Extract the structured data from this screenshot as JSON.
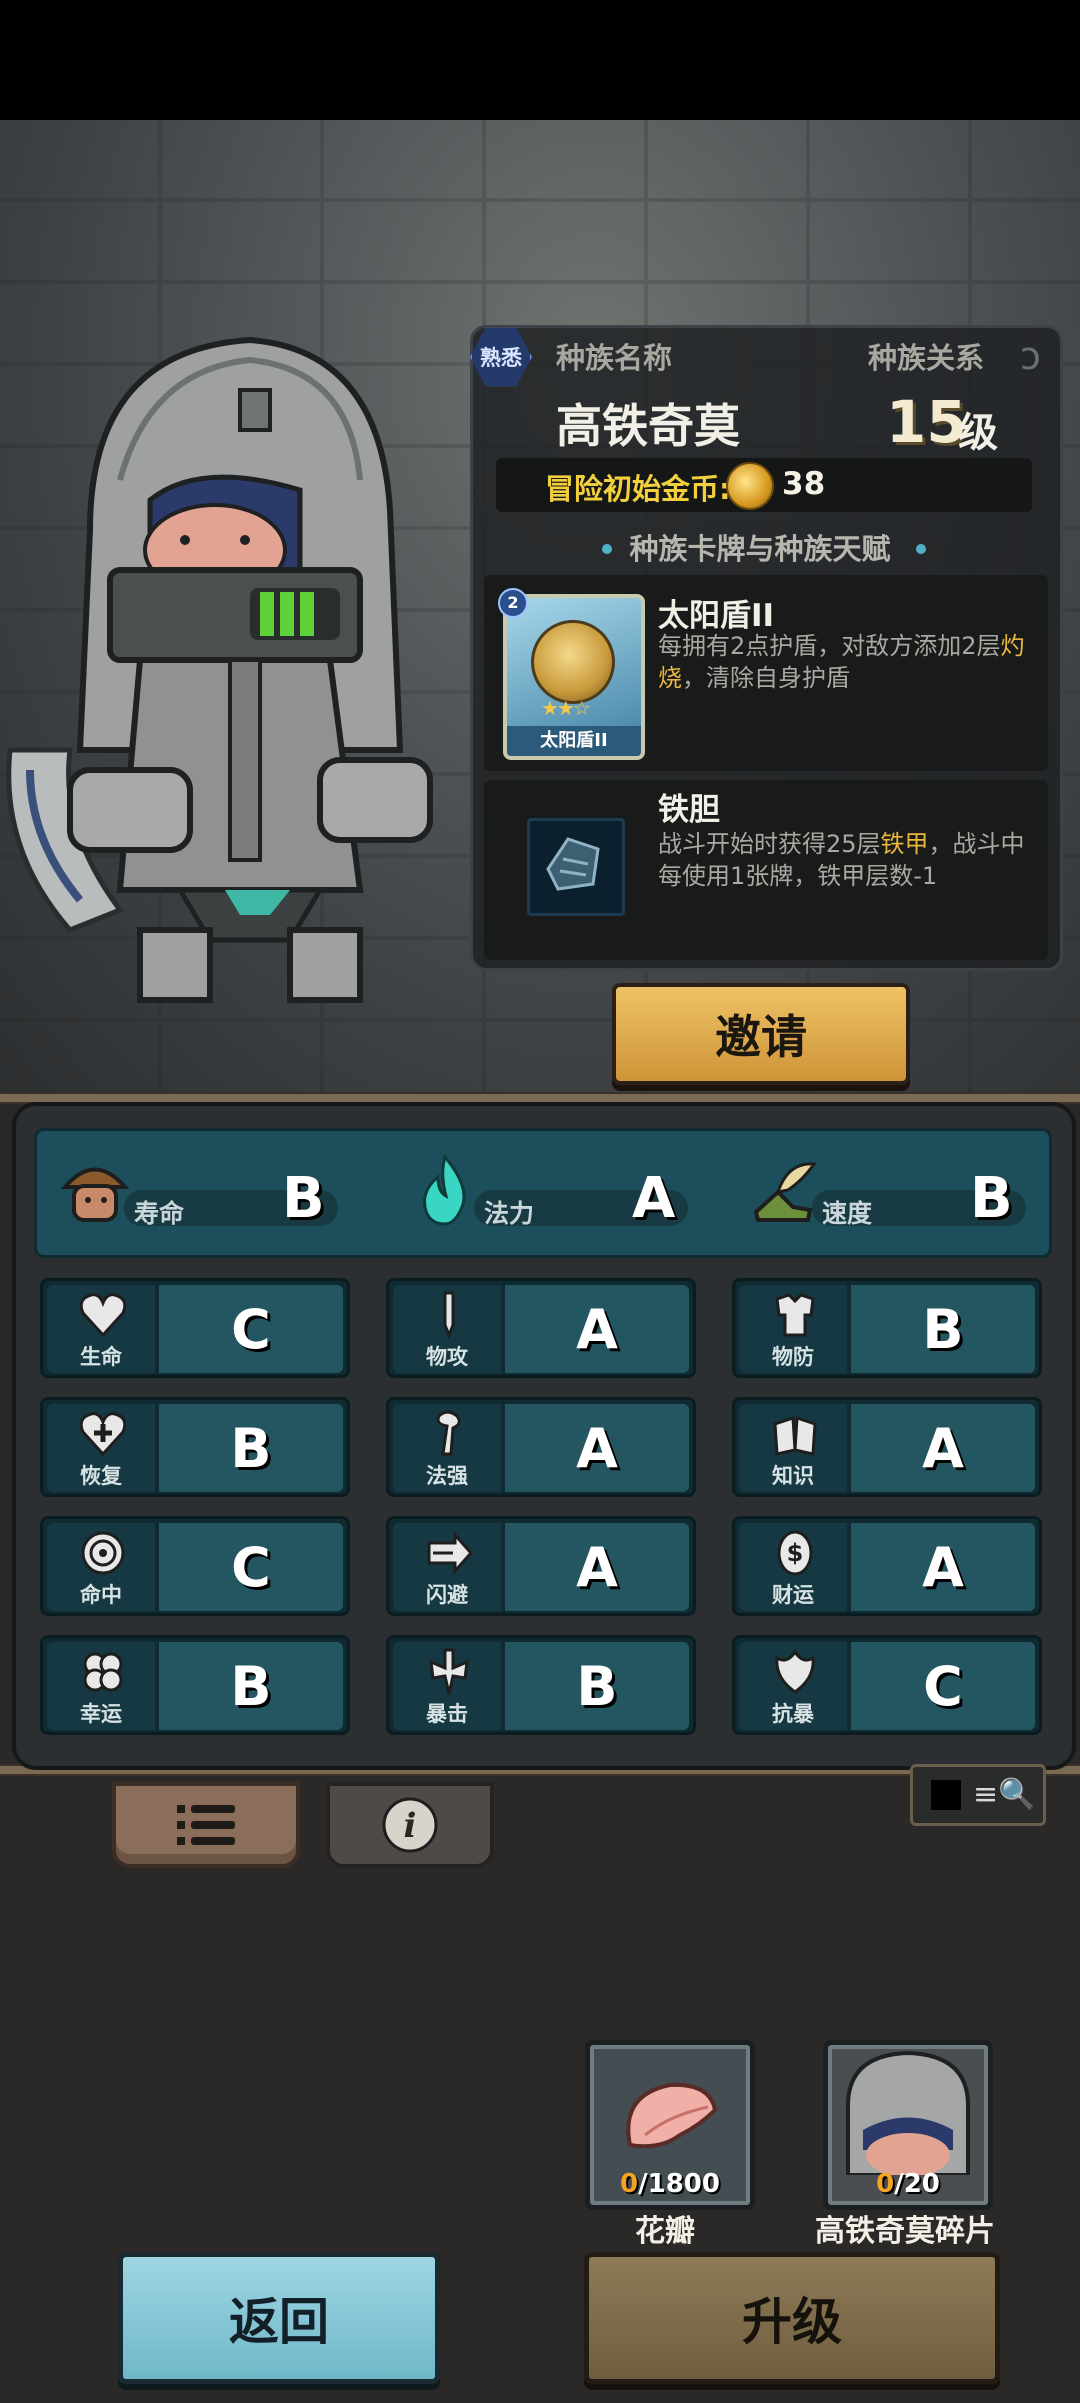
{
  "race": {
    "familiar_badge": "熟悉",
    "name_label": "种族名称",
    "relation_label": "种族关系",
    "name": "高铁奇莫",
    "level": "15",
    "level_unit": "级",
    "gold_label": "冒险初始金币:",
    "gold_value": "38",
    "section_title": "种族卡牌与种族天赋"
  },
  "card": {
    "level_badge": "2",
    "title": "太阳盾II",
    "thumb_name": "太阳盾II",
    "desc_part1": "每拥有2点护盾，对敌方添加2层",
    "desc_highlight": "灼烧",
    "desc_part2": "，清除自身护盾"
  },
  "talent": {
    "title": "铁胆",
    "desc_part1": "战斗开始时获得25层",
    "desc_highlight": "铁甲",
    "desc_part2": "，战斗中每使用1张牌，铁甲层数-1"
  },
  "invite_label": "邀请",
  "summary": [
    {
      "icon": "mushroom-head-icon",
      "label": "寿命",
      "grade": "B"
    },
    {
      "icon": "blue-flame-icon",
      "label": "法力",
      "grade": "A"
    },
    {
      "icon": "winged-boot-icon",
      "label": "速度",
      "grade": "B"
    }
  ],
  "stats": [
    {
      "icon": "heart-icon",
      "label": "生命",
      "grade": "C"
    },
    {
      "icon": "sword-icon",
      "label": "物攻",
      "grade": "A"
    },
    {
      "icon": "armor-icon",
      "label": "物防",
      "grade": "B"
    },
    {
      "icon": "heart-plus-icon",
      "label": "恢复",
      "grade": "B"
    },
    {
      "icon": "staff-icon",
      "label": "法强",
      "grade": "A"
    },
    {
      "icon": "book-icon",
      "label": "知识",
      "grade": "A"
    },
    {
      "icon": "target-icon",
      "label": "命中",
      "grade": "C"
    },
    {
      "icon": "dash-arrow-icon",
      "label": "闪避",
      "grade": "A"
    },
    {
      "icon": "coin-dollar-icon",
      "label": "财运",
      "grade": "A"
    },
    {
      "icon": "clover-icon",
      "label": "幸运",
      "grade": "B"
    },
    {
      "icon": "crit-icon",
      "label": "暴击",
      "grade": "B"
    },
    {
      "icon": "shield-flower-icon",
      "label": "抗暴",
      "grade": "C"
    }
  ],
  "resources": [
    {
      "name": "花瓣",
      "current": "0",
      "total": "/1800"
    },
    {
      "name": "高铁奇莫碎片",
      "current": "0",
      "total": "/20"
    }
  ],
  "back_label": "返回",
  "upgrade_label": "升级",
  "grid_toggle_icon": "≡🔍"
}
